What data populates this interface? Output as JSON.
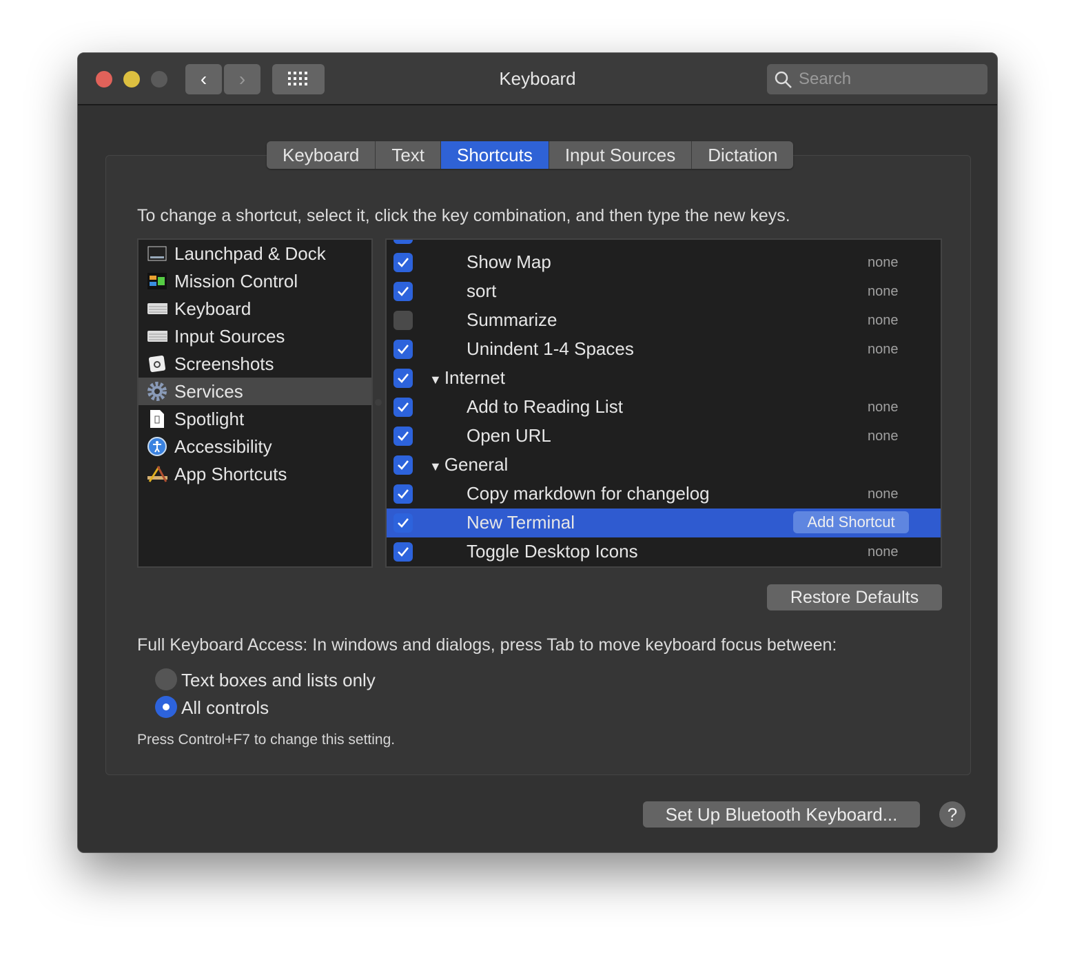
{
  "window": {
    "title": "Keyboard",
    "search_placeholder": "Search"
  },
  "tabs": [
    {
      "label": "Keyboard"
    },
    {
      "label": "Text"
    },
    {
      "label": "Shortcuts",
      "selected": true
    },
    {
      "label": "Input Sources"
    },
    {
      "label": "Dictation"
    }
  ],
  "instruction": "To change a shortcut, select it, click the key combination, and then type the new keys.",
  "categories": [
    {
      "label": "Launchpad & Dock",
      "icon": "launchpad-icon"
    },
    {
      "label": "Mission Control",
      "icon": "mission-control-icon"
    },
    {
      "label": "Keyboard",
      "icon": "keyboard-icon"
    },
    {
      "label": "Input Sources",
      "icon": "keyboard-icon"
    },
    {
      "label": "Screenshots",
      "icon": "screenshot-icon"
    },
    {
      "label": "Services",
      "icon": "gear-icon",
      "selected": true
    },
    {
      "label": "Spotlight",
      "icon": "spotlight-icon"
    },
    {
      "label": "Accessibility",
      "icon": "accessibility-icon"
    },
    {
      "label": "App Shortcuts",
      "icon": "app-shortcuts-icon"
    }
  ],
  "shortcuts": [
    {
      "label": "Show Map",
      "checked": true,
      "key": "none",
      "indent": 2
    },
    {
      "label": "sort",
      "checked": true,
      "key": "none",
      "indent": 2
    },
    {
      "label": "Summarize",
      "checked": false,
      "key": "none",
      "indent": 2
    },
    {
      "label": "Unindent 1-4 Spaces",
      "checked": true,
      "key": "none",
      "indent": 2
    },
    {
      "label": "Internet",
      "checked": true,
      "key": "",
      "indent": 1,
      "group": true
    },
    {
      "label": "Add to Reading List",
      "checked": true,
      "key": "none",
      "indent": 2
    },
    {
      "label": "Open URL",
      "checked": true,
      "key": "none",
      "indent": 2
    },
    {
      "label": "General",
      "checked": true,
      "key": "",
      "indent": 1,
      "group": true
    },
    {
      "label": "Copy markdown for changelog",
      "checked": true,
      "key": "none",
      "indent": 2
    },
    {
      "label": "New Terminal",
      "checked": true,
      "key": "Add Shortcut",
      "indent": 2,
      "selected": true
    },
    {
      "label": "Toggle Desktop Icons",
      "checked": true,
      "key": "none",
      "indent": 2
    }
  ],
  "restore_defaults": "Restore Defaults",
  "full_keyboard_access": {
    "label": "Full Keyboard Access: In windows and dialogs, press Tab to move keyboard focus between:",
    "options": [
      {
        "label": "Text boxes and lists only",
        "selected": false
      },
      {
        "label": "All controls",
        "selected": true
      }
    ],
    "note": "Press Control+F7 to change this setting."
  },
  "bluetooth_button": "Set Up Bluetooth Keyboard...",
  "help": "?",
  "colors": {
    "accent": "#2f62d6",
    "close": "#e0625a",
    "minimize": "#dcbf40"
  }
}
